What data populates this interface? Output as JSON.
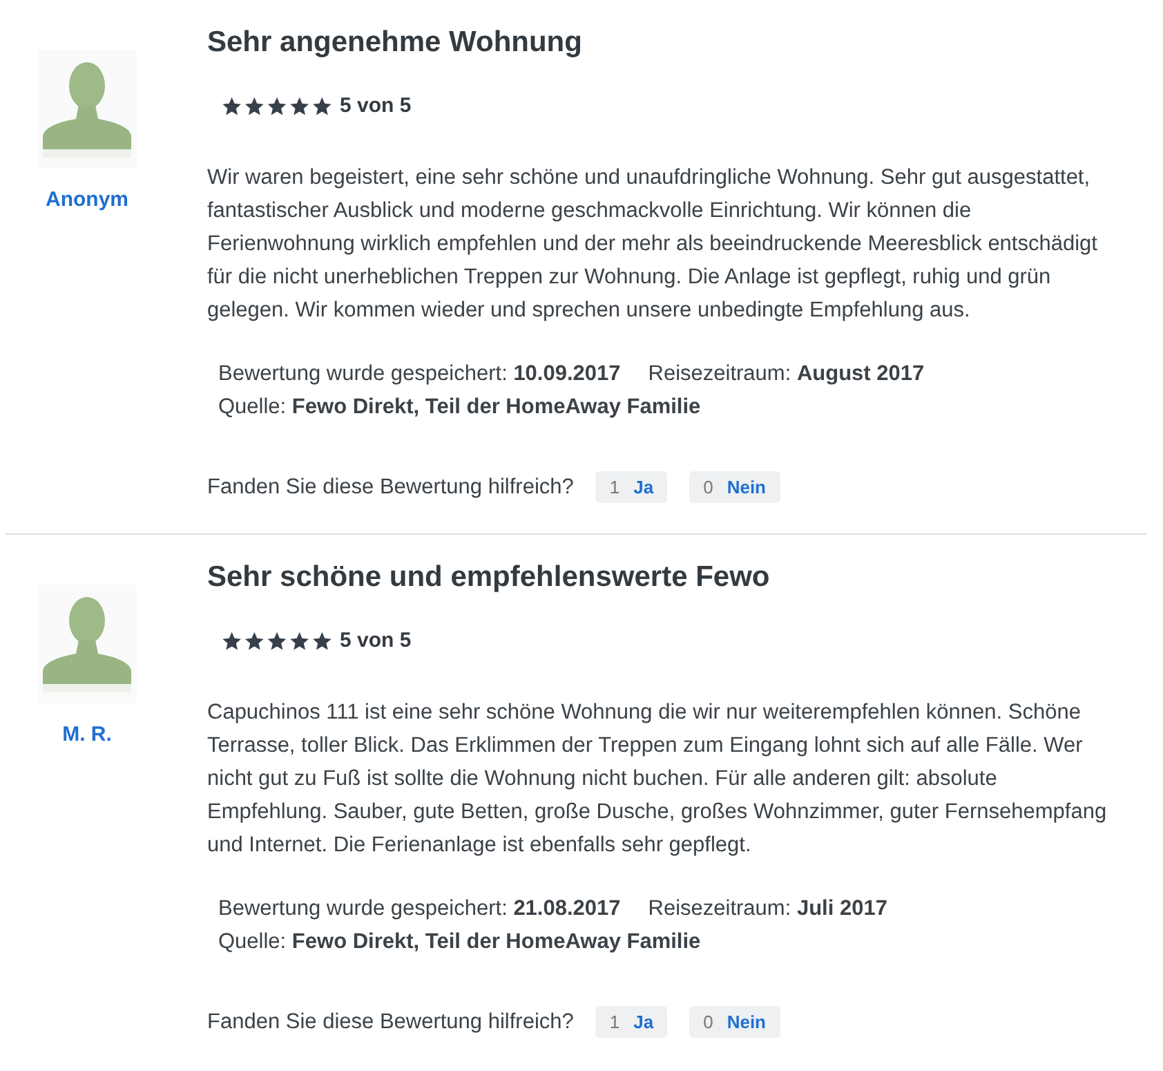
{
  "reviews": [
    {
      "author": "Anonym",
      "title": "Sehr angenehme Wohnung",
      "stars": 5,
      "rating": "5 von 5",
      "body": "Wir waren begeistert, eine sehr schöne und unaufdringliche Wohnung. Sehr gut ausgestattet, fantastischer Ausblick und moderne geschmackvolle Einrichtung. Wir können die Ferienwohnung wirklich empfehlen und der mehr als beeindruckende Meeresblick entschädigt für die nicht unerheblichen Treppen zur Wohnung. Die Anlage ist gepflegt, ruhig und grün gelegen. Wir kommen wieder und sprechen unsere unbedingte Empfehlung aus.",
      "saved": "Bewertung wurde gespeichert: **10.09.2017**",
      "period": "Reisezeitraum: **August 2017**",
      "source": "Quelle: **Fewo Direkt, Teil der HomeAway Familie**",
      "helpful_question": "Fanden Sie diese Bewertung hilfreich?",
      "yes_count": "1",
      "yes_label": "Ja",
      "no_count": "0",
      "no_label": "Nein"
    },
    {
      "author": "M. R.",
      "title": "Sehr schöne und empfehlenswerte Fewo",
      "stars": 5,
      "rating": "5 von 5",
      "body": "Capuchinos 111 ist eine sehr schöne Wohnung die wir nur weiterempfehlen können. Schöne Terrasse, toller Blick. Das Erklimmen der Treppen zum Eingang lohnt sich auf alle Fälle. Wer nicht gut zu Fuß ist sollte die Wohnung nicht buchen. Für alle anderen gilt: absolute Empfehlung. Sauber, gute Betten, große Dusche, großes Wohnzimmer, guter Fernsehempfang und Internet. Die Ferienanlage ist ebenfalls sehr gepflegt.",
      "saved": "Bewertung wurde gespeichert: **21.08.2017**",
      "period": "Reisezeitraum: **Juli 2017**",
      "source": "Quelle: **Fewo Direkt, Teil der HomeAway Familie**",
      "helpful_question": "Fanden Sie diese Bewertung hilfreich?",
      "yes_count": "1",
      "yes_label": "Ja",
      "no_count": "0",
      "no_label": "Nein"
    }
  ]
}
